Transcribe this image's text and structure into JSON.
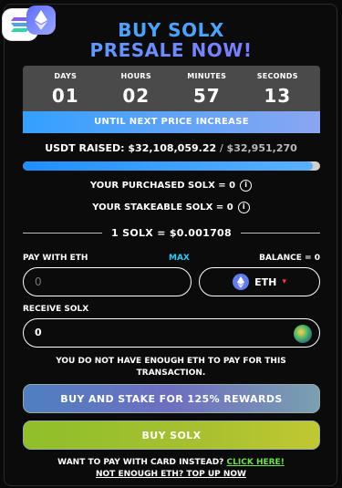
{
  "title": {
    "line1": "BUY SOLX",
    "line2": "PRESALE NOW!"
  },
  "countdown": {
    "units": [
      {
        "label": "DAYS",
        "value": "01"
      },
      {
        "label": "HOURS",
        "value": "02"
      },
      {
        "label": "MINUTES",
        "value": "57"
      },
      {
        "label": "SECONDS",
        "value": "13"
      }
    ],
    "banner": "UNTIL NEXT PRICE INCREASE"
  },
  "raised": {
    "label": "USDT RAISED:",
    "amount": "$32,108,059.22",
    "separator": "/",
    "goal": "$32,951,270",
    "progress_fraction": 0.974
  },
  "purchased": {
    "text": "YOUR PURCHASED SOLX = 0",
    "info": "i"
  },
  "stakeable": {
    "text": "YOUR STAKEABLE SOLX = 0",
    "info": "i"
  },
  "rate": "1 SOLX = $0.001708",
  "pay": {
    "label": "PAY WITH ETH",
    "max": "MAX",
    "balance": "BALANCE = 0",
    "value": "0",
    "currency": "ETH",
    "currency_caret": "▾"
  },
  "receive": {
    "label": "RECEIVE SOLX",
    "value": "0"
  },
  "warning": "YOU DO NOT HAVE ENOUGH ETH TO PAY FOR THIS TRANSACTION.",
  "buttons": {
    "stake": "BUY AND STAKE FOR 125% REWARDS",
    "buy": "BUY SOLX"
  },
  "footer": {
    "card_text": "WANT TO PAY WITH CARD INSTEAD?",
    "card_link": "CLICK HERE!",
    "topup": "NOT ENOUGH ETH? TOP UP NOW"
  },
  "colors": {
    "accent_blue": "#4ba3ff",
    "accent_purple": "#7a6bff",
    "max_link": "#33c7f5",
    "card_link": "#6ee04a",
    "buy_green": "#a8c030"
  },
  "icons": [
    "solana-logo-icon",
    "ethereum-logo-icon",
    "info-icon",
    "eth-coin-icon",
    "solx-token-icon"
  ]
}
